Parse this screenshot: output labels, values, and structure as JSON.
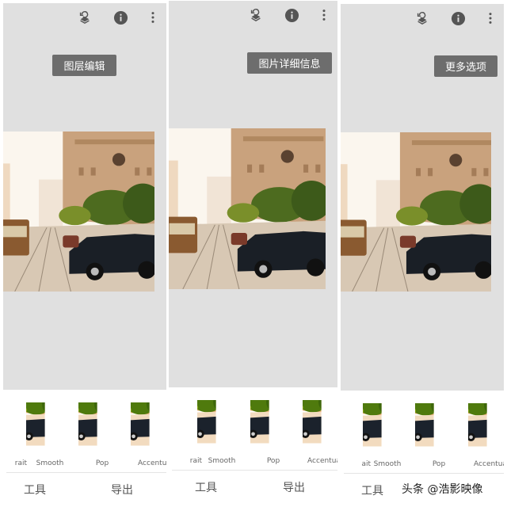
{
  "panels": [
    {
      "tooltip": "图层编辑",
      "filters": [
        "rait",
        "Smooth",
        "Pop",
        "Accentua"
      ],
      "nav": {
        "tools": "工具",
        "export": "导出"
      }
    },
    {
      "tooltip": "图片详细信息",
      "filters": [
        "rait",
        "Smooth",
        "Pop",
        "Accentua"
      ],
      "nav": {
        "tools": "工具",
        "export": "导出"
      }
    },
    {
      "tooltip": "更多选项",
      "filters": [
        "ait",
        "Smooth",
        "Pop",
        "Accentua"
      ],
      "nav": {
        "tools": "工具"
      }
    }
  ],
  "icons": [
    "layers-undo-icon",
    "info-icon",
    "more-vert-icon"
  ],
  "watermark": "头条 @浩影映像",
  "colors": {
    "canvas": "#e0e0e0",
    "tooltip": "#6d6d6d"
  }
}
